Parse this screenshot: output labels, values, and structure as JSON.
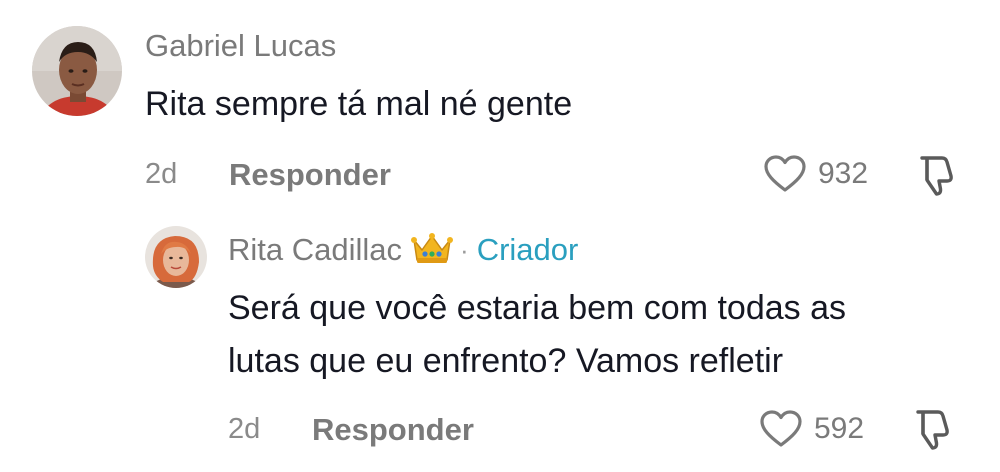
{
  "comments": [
    {
      "username": "Gabriel Lucas",
      "text": "Rita sempre tá mal né gente",
      "time": "2d",
      "reply_label": "Responder",
      "likes": "932",
      "avatar_icon": "user-avatar",
      "like_icon": "heart-outline-icon",
      "dislike_icon": "thumbs-down-icon"
    },
    {
      "username": "Rita Cadillac",
      "badge_icon": "crown-emoji",
      "separator": "·",
      "role_label": "Criador",
      "text_lines": [
        "Será que você estaria bem com todas as",
        "lutas que eu enfrento? Vamos refletir"
      ],
      "time": "2d",
      "reply_label": "Responder",
      "likes": "592",
      "avatar_icon": "creator-avatar",
      "like_icon": "heart-outline-icon",
      "dislike_icon": "thumbs-down-icon"
    }
  ],
  "colors": {
    "creator_accent": "#2a9fbf",
    "secondary_text": "#7a7a7a",
    "primary_text": "#161823"
  }
}
